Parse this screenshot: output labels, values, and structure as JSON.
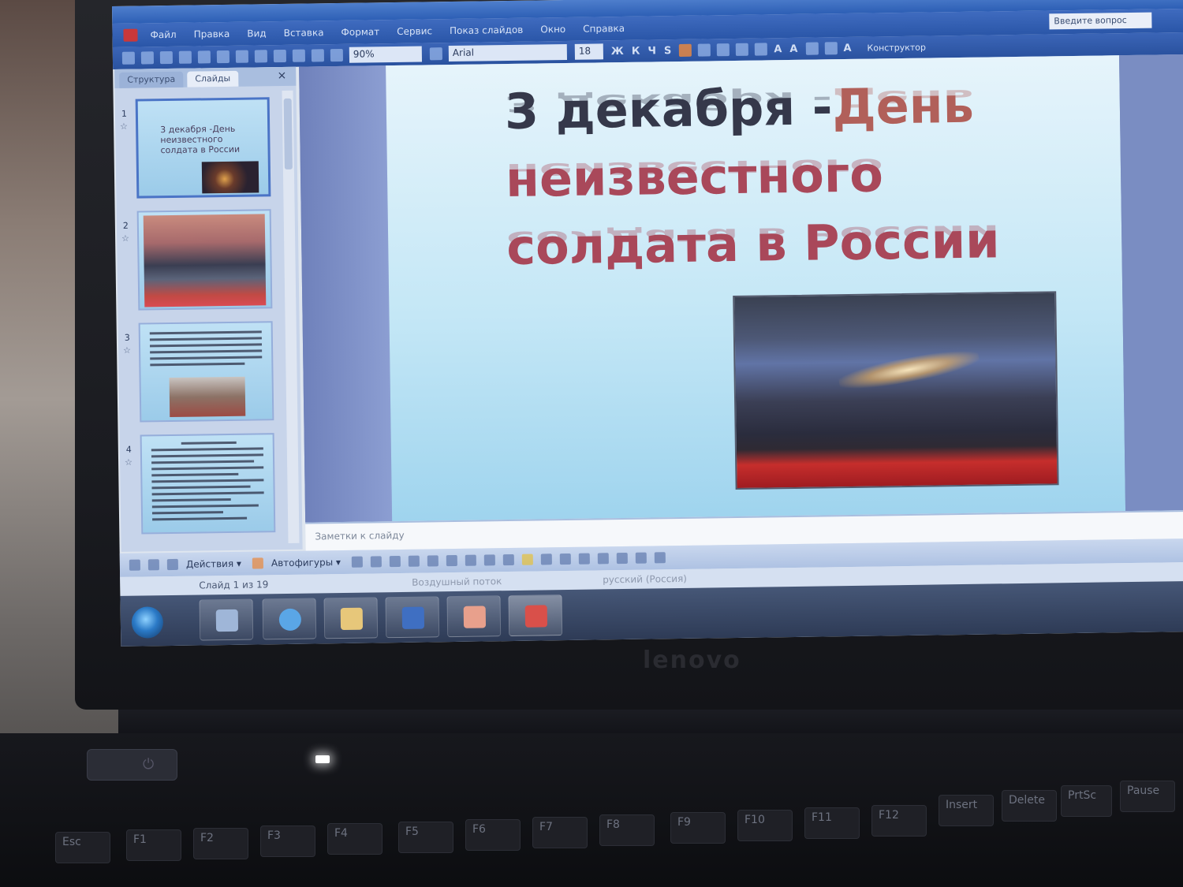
{
  "window": {
    "menu": [
      "Файл",
      "Правка",
      "Вид",
      "Вставка",
      "Формат",
      "Сервис",
      "Показ слайдов",
      "Окно",
      "Справка"
    ],
    "help_placeholder": "Введите вопрос"
  },
  "toolbar": {
    "zoom": "90%",
    "font": "Arial",
    "font_size": "18",
    "designer": "Конструктор"
  },
  "slides_panel": {
    "tab_outline": "Структура",
    "tab_slides": "Слайды",
    "close": "×",
    "thumbnails": [
      {
        "number": "1",
        "title": "3 декабря -День неизвестного солдата в России"
      },
      {
        "number": "2"
      },
      {
        "number": "3"
      },
      {
        "number": "4"
      }
    ]
  },
  "slide": {
    "title_line1_part1": "3 декабря -",
    "title_line1_part2": "День",
    "title_line2": "неизвестного",
    "title_line3": "солдата в России"
  },
  "notes": {
    "placeholder": "Заметки к слайду"
  },
  "draw_toolbar": {
    "actions": "Действия ▾",
    "autoshapes": "Автофигуры ▾"
  },
  "status": {
    "slide_counter": "Слайд 1 из 19",
    "design": "Воздушный поток",
    "language": "русский (Россия)"
  },
  "laptop": {
    "brand": "lenovo",
    "keys": [
      "Esc",
      "F1",
      "F2",
      "F3",
      "F4",
      "F5",
      "F6",
      "F7",
      "F8",
      "F9",
      "F10",
      "F11",
      "F12",
      "Insert",
      "Delete",
      "PrtSc",
      "Pause"
    ]
  },
  "colors": {
    "title_dark": "#35384a",
    "title_rose": "#a9485a",
    "taskbar": "#2e3b56"
  }
}
